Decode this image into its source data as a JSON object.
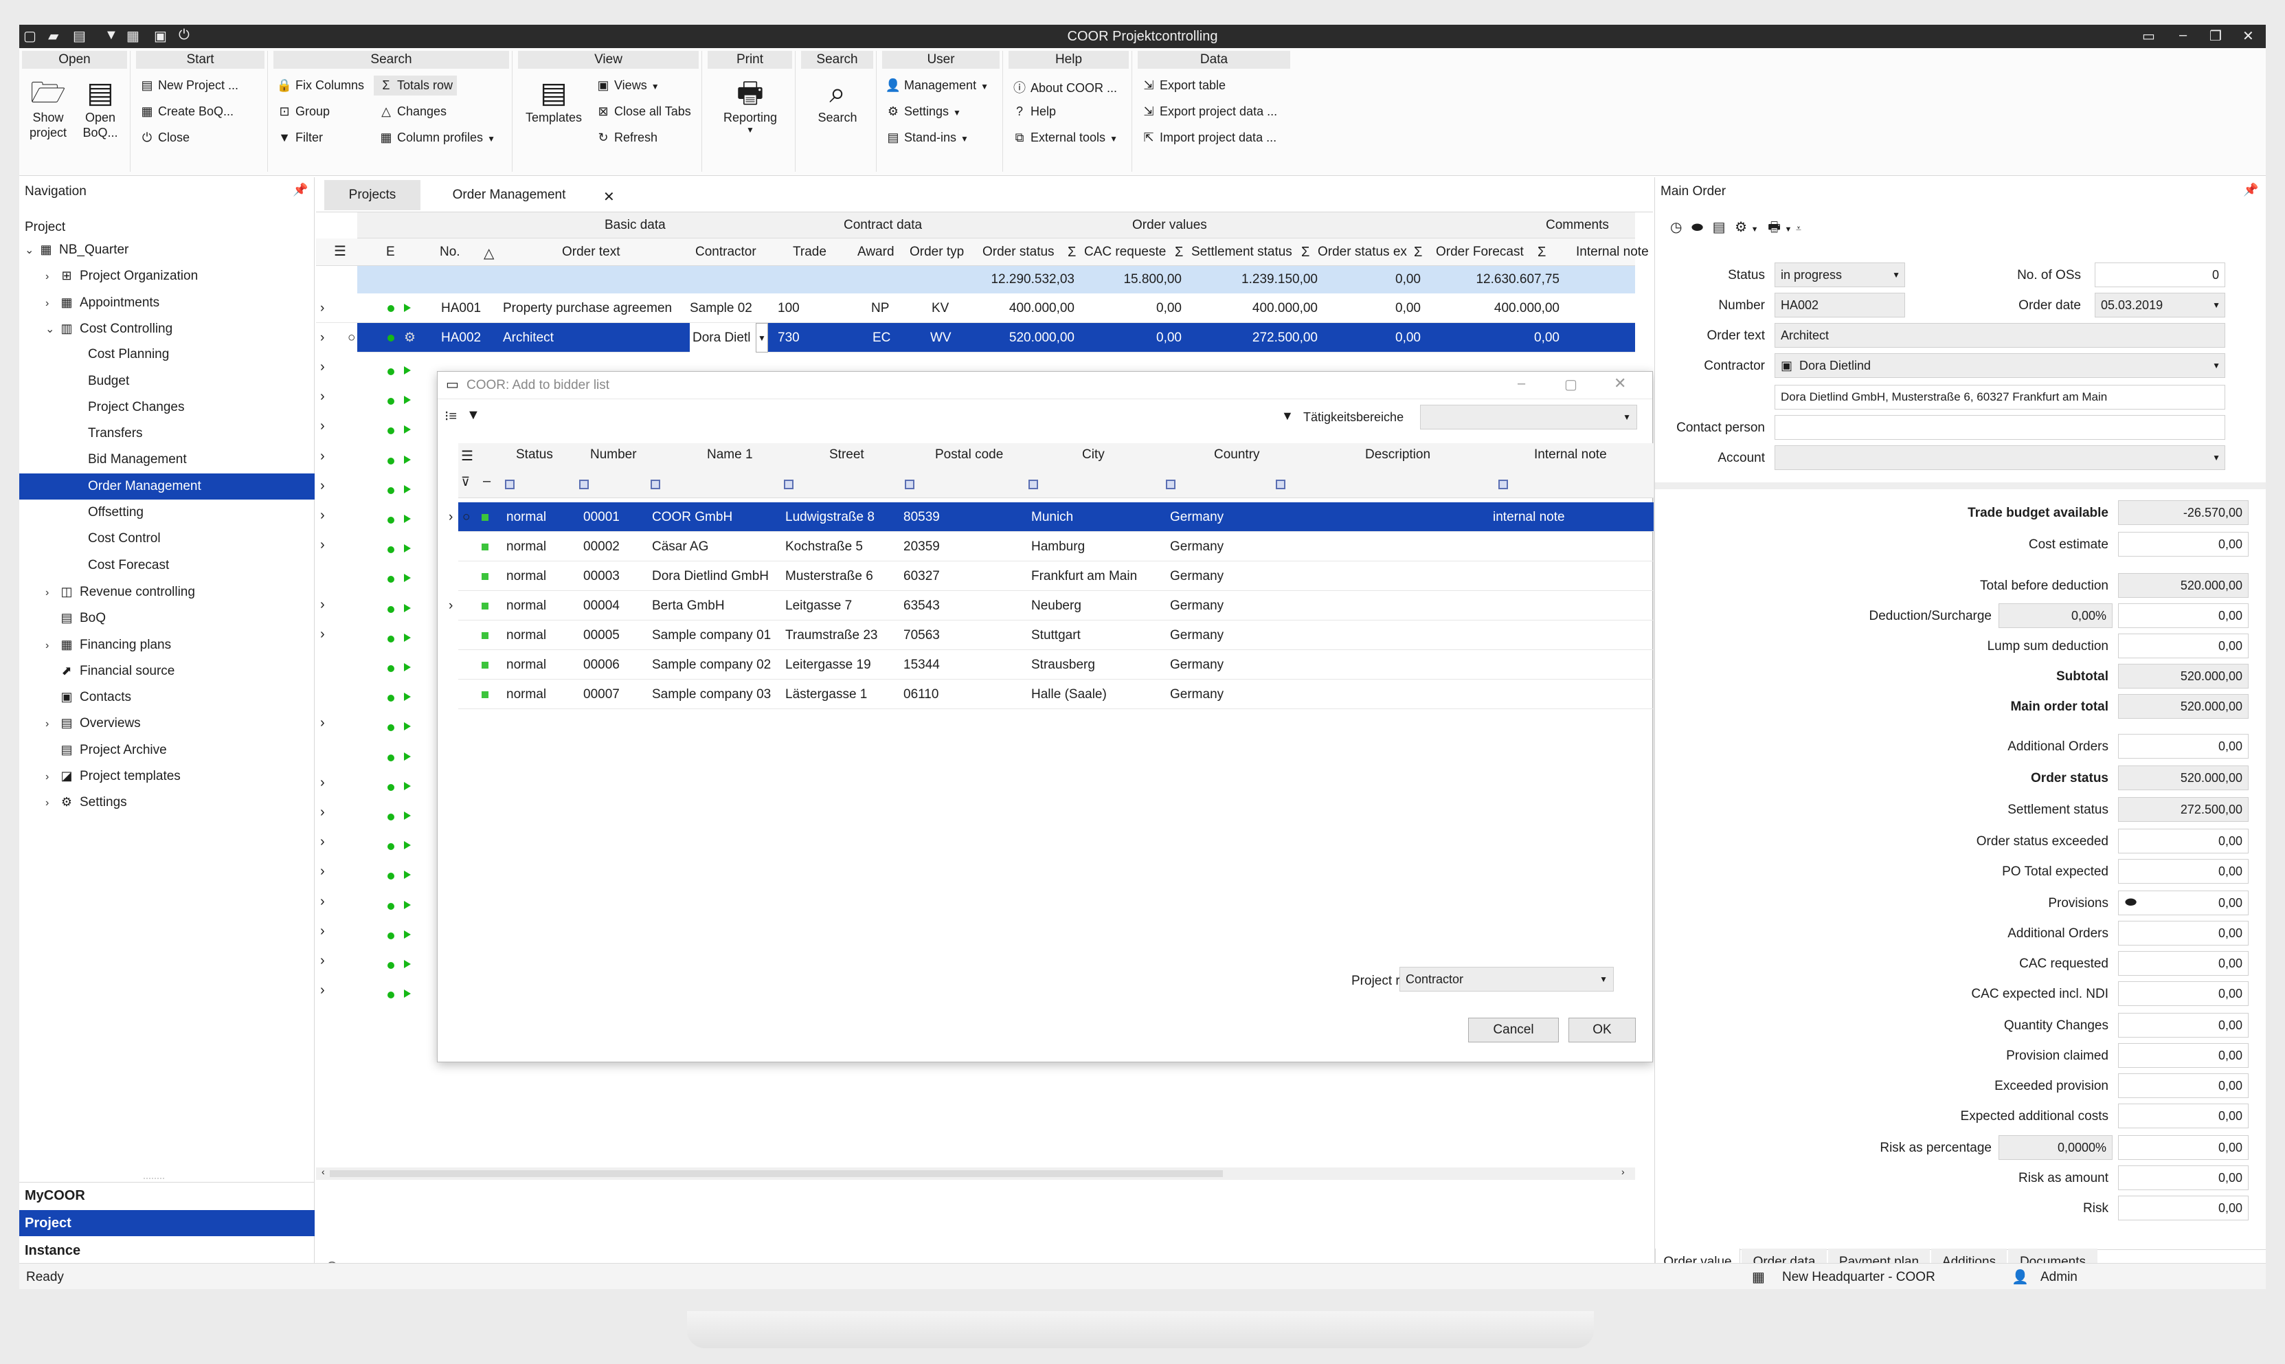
{
  "window": {
    "title": "COOR Projektcontrolling"
  },
  "ribbon": {
    "open": {
      "header": "Open",
      "show_project": "Show project",
      "open_boq": "Open BoQ..."
    },
    "start": {
      "header": "Start",
      "new_project": "New Project ...",
      "create_boq": "Create BoQ...",
      "close": "Close"
    },
    "search_grp": {
      "header": "Search",
      "fix_columns": "Fix Columns",
      "totals_row": "Totals row",
      "group": "Group",
      "changes": "Changes",
      "filter": "Filter",
      "column_profiles": "Column profiles"
    },
    "view": {
      "header": "View",
      "templates": "Templates",
      "views": "Views",
      "close_all_tabs": "Close all Tabs",
      "refresh": "Refresh"
    },
    "print": {
      "header": "Print",
      "reporting": "Reporting"
    },
    "search": {
      "header": "Search",
      "search": "Search"
    },
    "user": {
      "header": "User",
      "management": "Management",
      "settings": "Settings",
      "stand_ins": "Stand-ins"
    },
    "help": {
      "header": "Help",
      "about": "About COOR ...",
      "help": "Help",
      "external_tools": "External tools"
    },
    "data": {
      "header": "Data",
      "export_table": "Export table",
      "export_project_data": "Export project data ...",
      "import_project_data": "Import project data ..."
    }
  },
  "navigation": {
    "title": "Navigation",
    "root": "Project",
    "items": [
      {
        "label": "NB_Quarter",
        "icon": "building-icon"
      },
      {
        "label": "Project Organization",
        "icon": "org-chart-icon"
      },
      {
        "label": "Appointments",
        "icon": "calendar-icon"
      },
      {
        "label": "Cost Controlling",
        "icon": "bar-chart-icon"
      },
      {
        "label": "Cost Planning"
      },
      {
        "label": "Budget"
      },
      {
        "label": "Project Changes"
      },
      {
        "label": "Transfers"
      },
      {
        "label": "Bid Management"
      },
      {
        "label": "Order Management"
      },
      {
        "label": "Offsetting"
      },
      {
        "label": "Cost Control"
      },
      {
        "label": "Cost Forecast"
      },
      {
        "label": "Revenue controlling",
        "icon": "revenue-icon"
      },
      {
        "label": "BoQ",
        "icon": "boq-icon"
      },
      {
        "label": "Financing plans",
        "icon": "calendar-icon"
      },
      {
        "label": "Financial source",
        "icon": "financial-source-icon"
      },
      {
        "label": "Contacts",
        "icon": "contacts-icon"
      },
      {
        "label": "Overviews",
        "icon": "document-icon"
      },
      {
        "label": "Project Archive",
        "icon": "archive-icon"
      },
      {
        "label": "Project templates",
        "icon": "template-icon"
      },
      {
        "label": "Settings",
        "icon": "gear-icon"
      }
    ],
    "footer": [
      "MyCOOR",
      "Project",
      "Instance"
    ]
  },
  "tabs": {
    "projects": "Projects",
    "order_management": "Order Management"
  },
  "grid": {
    "bands": {
      "basic": "Basic data",
      "contract": "Contract data",
      "values": "Order values",
      "comments": "Comments"
    },
    "columns": [
      "E",
      "No.",
      "Order text",
      "Contractor",
      "Trade",
      "Award",
      "Order typ",
      "Order status",
      "CAC requeste",
      "Settlement status",
      "Order status ex",
      "Order Forecast",
      "Internal note"
    ],
    "totals": [
      "12.290.532,03",
      "15.800,00",
      "1.239.150,00",
      "0,00",
      "12.630.607,75"
    ],
    "rows": [
      {
        "no": "HA001",
        "text": "Property purchase agreemen",
        "contractor": "Sample 02",
        "trade": "100",
        "award": "NP",
        "type": "KV",
        "status": "400.000,00",
        "cac": "0,00",
        "settlement": "400.000,00",
        "exceeded": "0,00",
        "forecast": "400.000,00"
      },
      {
        "no": "HA002",
        "text": "Architect",
        "contractor": "Dora Dietl",
        "trade": "730",
        "award": "EC",
        "type": "WV",
        "status": "520.000,00",
        "cac": "0,00",
        "settlement": "272.500,00",
        "exceeded": "0,00",
        "forecast": "0,00"
      }
    ]
  },
  "dialog": {
    "title": "COOR: Add to bidder list",
    "filter_label": "Tätigkeitsbereiche",
    "columns": [
      "Status",
      "Number",
      "Name 1",
      "Street",
      "Postal code",
      "City",
      "Country",
      "Description",
      "Internal note"
    ],
    "rows": [
      {
        "status": "normal",
        "number": "00001",
        "name": "COOR GmbH",
        "street": "Ludwigstraße 8",
        "postal": "80539",
        "city": "Munich",
        "country": "Germany",
        "note": "internal note"
      },
      {
        "status": "normal",
        "number": "00002",
        "name": "Cäsar AG",
        "street": "Kochstraße 5",
        "postal": "20359",
        "city": "Hamburg",
        "country": "Germany",
        "note": ""
      },
      {
        "status": "normal",
        "number": "00003",
        "name": "Dora Dietlind GmbH",
        "street": "Musterstraße 6",
        "postal": "60327",
        "city": "Frankfurt am Main",
        "country": "Germany",
        "note": ""
      },
      {
        "status": "normal",
        "number": "00004",
        "name": "Berta GmbH",
        "street": "Leitgasse 7",
        "postal": "63543",
        "city": "Neuberg",
        "country": "Germany",
        "note": ""
      },
      {
        "status": "normal",
        "number": "00005",
        "name": "Sample company 01",
        "street": "Traumstraße 23",
        "postal": "70563",
        "city": "Stuttgart",
        "country": "Germany",
        "note": ""
      },
      {
        "status": "normal",
        "number": "00006",
        "name": "Sample company 02",
        "street": "Leitergasse 19",
        "postal": "15344",
        "city": "Strausberg",
        "country": "Germany",
        "note": ""
      },
      {
        "status": "normal",
        "number": "00007",
        "name": "Sample company 03",
        "street": "Lästergasse 1",
        "postal": "06110",
        "city": "Halle (Saale)",
        "country": "Germany",
        "note": ""
      }
    ],
    "project_role_label": "Project role",
    "project_role_value": "Contractor",
    "cancel": "Cancel",
    "ok": "OK"
  },
  "main_order": {
    "title": "Main Order",
    "status_label": "Status",
    "status_value": "in progress",
    "os_label": "No. of OSs",
    "os_value": "0",
    "number_label": "Number",
    "number_value": "HA002",
    "date_label": "Order date",
    "date_value": "05.03.2019",
    "text_label": "Order text",
    "text_value": "Architect",
    "contractor_label": "Contractor",
    "contractor_value": "Dora Dietlind",
    "address_value": "Dora Dietlind GmbH, Musterstraße 6, 60327 Frankfurt am Main",
    "contact_label": "Contact person",
    "account_label": "Account",
    "values": [
      {
        "label": "Trade budget available",
        "value": "-26.570,00",
        "bold": true
      },
      {
        "label": "Cost estimate",
        "value": "0,00"
      },
      {
        "label": "Total before deduction",
        "value": "520.000,00"
      },
      {
        "label": "Deduction/Surcharge",
        "value": "0,00",
        "pct": "0,00%"
      },
      {
        "label": "Lump sum deduction",
        "value": "0,00"
      },
      {
        "label": "Subtotal",
        "value": "520.000,00",
        "bold": true
      },
      {
        "label": "Main order total",
        "value": "520.000,00",
        "bold": true
      },
      {
        "label": "Additional Orders",
        "value": "0,00"
      },
      {
        "label": "Order status",
        "value": "520.000,00",
        "bold": true
      },
      {
        "label": "Settlement status",
        "value": "272.500,00"
      },
      {
        "label": "Order status exceeded",
        "value": "0,00"
      },
      {
        "label": "PO Total expected",
        "value": "0,00"
      },
      {
        "label": "Provisions",
        "value": "0,00"
      },
      {
        "label": "Additional Orders",
        "value": "0,00"
      },
      {
        "label": "CAC requested",
        "value": "0,00"
      },
      {
        "label": "CAC expected incl. NDI",
        "value": "0,00"
      },
      {
        "label": "Quantity Changes",
        "value": "0,00"
      },
      {
        "label": "Provision claimed",
        "value": "0,00"
      },
      {
        "label": "Exceeded provision",
        "value": "0,00"
      },
      {
        "label": "Expected additional costs",
        "value": "0,00"
      },
      {
        "label": "Risk as percentage",
        "value": "0,00",
        "pct": "0,0000%"
      },
      {
        "label": "Risk as amount",
        "value": "0,00"
      },
      {
        "label": "Risk",
        "value": "0,00"
      }
    ],
    "tabs": [
      "Order value",
      "Order data",
      "Payment plan",
      "Additions",
      "Documents"
    ]
  },
  "statusbar": {
    "status": "Ready",
    "location": "New Headquarter - COOR",
    "user": "Admin"
  }
}
